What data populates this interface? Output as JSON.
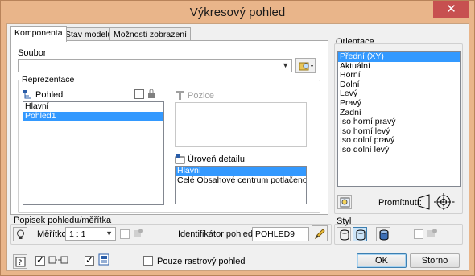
{
  "window": {
    "title": "Výkresový pohled",
    "close_glyph": "✕"
  },
  "tabs": [
    {
      "label": "Komponenta"
    },
    {
      "label": "Stav modelu"
    },
    {
      "label": "Možnosti zobrazení"
    }
  ],
  "component": {
    "file_label": "Soubor",
    "file_value": "",
    "representation_label": "Reprezentace",
    "view_label": "Pohled",
    "view_items": [
      {
        "label": "Hlavní",
        "selected": false
      },
      {
        "label": "Pohled1",
        "selected": true
      }
    ],
    "position_label": "Pozice",
    "detail_level_label": "Úroveň detailu",
    "detail_items": [
      {
        "label": "Hlavní",
        "selected": true
      },
      {
        "label": "Celé Obsahové centrum potlačeno",
        "selected": false
      }
    ]
  },
  "orientation": {
    "label": "Orientace",
    "items": [
      {
        "label": "Přední (XY)",
        "selected": true
      },
      {
        "label": "Aktuální",
        "selected": false
      },
      {
        "label": "Horní",
        "selected": false
      },
      {
        "label": "Dolní",
        "selected": false
      },
      {
        "label": "Levý",
        "selected": false
      },
      {
        "label": "Pravý",
        "selected": false
      },
      {
        "label": "Zadní",
        "selected": false
      },
      {
        "label": "Iso horní pravý",
        "selected": false
      },
      {
        "label": "Iso horní levý",
        "selected": false
      },
      {
        "label": "Iso dolní pravý",
        "selected": false
      },
      {
        "label": "Iso dolní levý",
        "selected": false
      }
    ],
    "projection_label": "Promítnutí:"
  },
  "label_scale": {
    "group_label": "Popisek pohledu/měřítka",
    "scale_label": "Měřítko",
    "scale_value": "1 : 1",
    "identifier_label": "Identifikátor pohledu",
    "identifier_value": "POHLED9"
  },
  "style": {
    "label": "Styl"
  },
  "footer": {
    "raster_only_label": "Pouze rastrový pohled",
    "ok_label": "OK",
    "cancel_label": "Storno"
  },
  "colors": {
    "selection": "#3399ff",
    "title_bar": "#e9b58a",
    "close_button": "#c75050"
  }
}
